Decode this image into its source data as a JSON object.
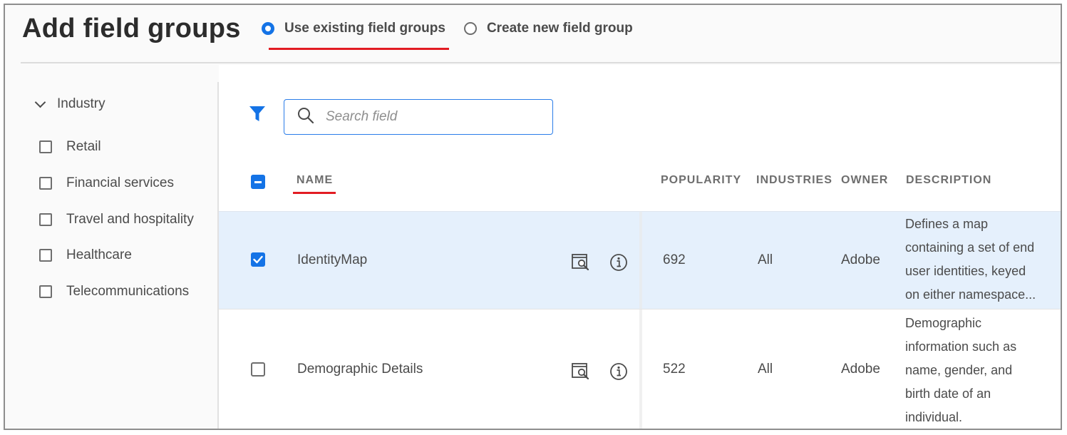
{
  "header": {
    "title": "Add field groups",
    "mode_options": [
      {
        "label": "Use existing field groups",
        "selected": true
      },
      {
        "label": "Create new field group",
        "selected": false
      }
    ]
  },
  "sidebar": {
    "section_label": "Industry",
    "filters": [
      {
        "label": "Retail",
        "checked": false
      },
      {
        "label": "Financial services",
        "checked": false
      },
      {
        "label": "Travel and hospitality",
        "checked": false
      },
      {
        "label": "Healthcare",
        "checked": false
      },
      {
        "label": "Telecommunications",
        "checked": false
      }
    ]
  },
  "search": {
    "placeholder": "Search field",
    "value": ""
  },
  "table": {
    "columns": [
      "NAME",
      "POPULARITY",
      "INDUSTRIES",
      "OWNER",
      "DESCRIPTION"
    ],
    "rows": [
      {
        "checked": true,
        "name": "IdentityMap",
        "popularity": "692",
        "industries": "All",
        "owner": "Adobe",
        "description_lines": [
          "Defines a map",
          "containing a set of end",
          "user identities, keyed",
          "on either namespace..."
        ]
      },
      {
        "checked": false,
        "name": "Demographic Details",
        "popularity": "522",
        "industries": "All",
        "owner": "Adobe",
        "description_lines": [
          "Demographic",
          "information such as",
          "name, gender, and",
          "birth date of an",
          "individual."
        ]
      }
    ]
  },
  "colors": {
    "accent": "#1473e6",
    "highlight_underline": "#e21c23",
    "selected_row": "#e5f0fc"
  },
  "icons": [
    "filter-icon",
    "search-icon",
    "preview-icon",
    "info-icon",
    "chevron-down-icon",
    "checkmark-icon"
  ]
}
